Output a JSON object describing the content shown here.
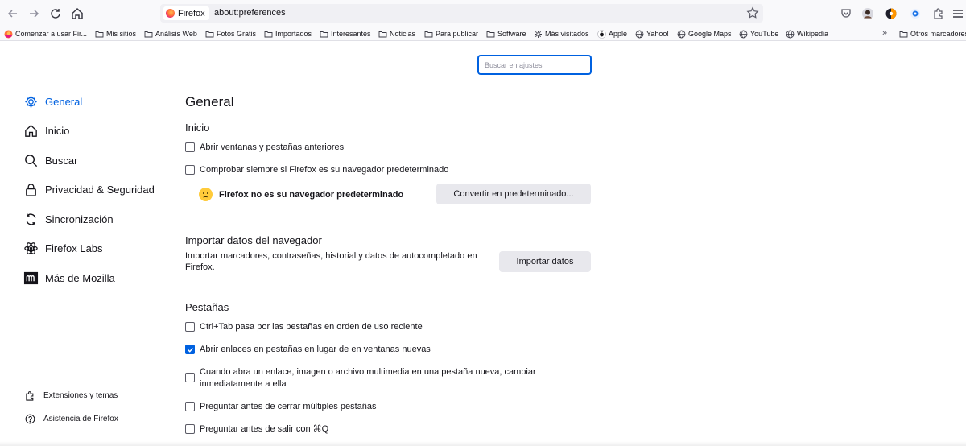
{
  "toolbar": {
    "back_icon": "back-arrow-icon",
    "forward_icon": "forward-arrow-icon",
    "reload_icon": "reload-icon",
    "home_icon": "home-icon",
    "identity_label": "Firefox",
    "url": "about:preferences"
  },
  "bookmarks": [
    {
      "label": "Comenzar a usar Fir...",
      "icon": "firefox-icon"
    },
    {
      "label": "Mis sitios",
      "icon": "folder-icon"
    },
    {
      "label": "Análisis Web",
      "icon": "folder-icon"
    },
    {
      "label": "Fotos Gratis",
      "icon": "folder-icon"
    },
    {
      "label": "Importados",
      "icon": "folder-icon"
    },
    {
      "label": "Interesantes",
      "icon": "folder-icon"
    },
    {
      "label": "Noticias",
      "icon": "folder-icon"
    },
    {
      "label": "Para publicar",
      "icon": "folder-icon"
    },
    {
      "label": "Software",
      "icon": "folder-icon"
    },
    {
      "label": "Más visitados",
      "icon": "gear-icon"
    },
    {
      "label": "Apple",
      "icon": "apple-icon"
    },
    {
      "label": "Yahoo!",
      "icon": "globe-icon"
    },
    {
      "label": "Google Maps",
      "icon": "globe-icon"
    },
    {
      "label": "YouTube",
      "icon": "globe-icon"
    },
    {
      "label": "Wikipedia",
      "icon": "globe-icon"
    }
  ],
  "bookmarks_other": "Otros marcadores",
  "search": {
    "placeholder": "Buscar en ajustes"
  },
  "sidebar": {
    "items": [
      {
        "label": "General",
        "icon": "gear-icon",
        "active": true
      },
      {
        "label": "Inicio",
        "icon": "home-icon",
        "active": false
      },
      {
        "label": "Buscar",
        "icon": "search-icon",
        "active": false
      },
      {
        "label": "Privacidad & Seguridad",
        "icon": "lock-icon",
        "active": false
      },
      {
        "label": "Sincronización",
        "icon": "sync-icon",
        "active": false
      },
      {
        "label": "Firefox Labs",
        "icon": "atom-icon",
        "active": false
      },
      {
        "label": "Más de Mozilla",
        "icon": "mozilla-icon",
        "active": false
      }
    ],
    "footer": [
      {
        "label": "Extensiones y temas",
        "icon": "puzzle-icon"
      },
      {
        "label": "Asistencia de Firefox",
        "icon": "help-icon"
      }
    ]
  },
  "main": {
    "title": "General",
    "startup": {
      "heading": "Inicio",
      "restore_session": {
        "label": "Abrir ventanas y pestañas anteriores",
        "checked": false
      },
      "check_default": {
        "label": "Comprobar siempre si Firefox es su navegador predeterminado",
        "checked": false
      },
      "default_status": "Firefox no es su navegador predeterminado",
      "set_default_button": "Convertir en predeterminado..."
    },
    "import": {
      "heading": "Importar datos del navegador",
      "description": "Importar marcadores, contraseñas, historial y datos de autocompletado en Firefox.",
      "button": "Importar datos"
    },
    "tabs": {
      "heading": "Pestañas",
      "options": [
        {
          "label": "Ctrl+Tab pasa por las pestañas en orden de uso reciente",
          "checked": false
        },
        {
          "label": "Abrir enlaces en pestañas en lugar de en ventanas nuevas",
          "checked": true
        },
        {
          "label": "Cuando abra un enlace, imagen o archivo multimedia en una pestaña nueva, cambiar inmediatamente a ella",
          "checked": false
        },
        {
          "label": "Preguntar antes de cerrar múltiples pestañas",
          "checked": false
        },
        {
          "label": "Preguntar antes de salir con ⌘Q",
          "checked": false
        }
      ]
    }
  },
  "colors": {
    "accent": "#0061e0",
    "button_bg": "#e8e8ed",
    "toolbar_bg": "#f9f9fb"
  }
}
